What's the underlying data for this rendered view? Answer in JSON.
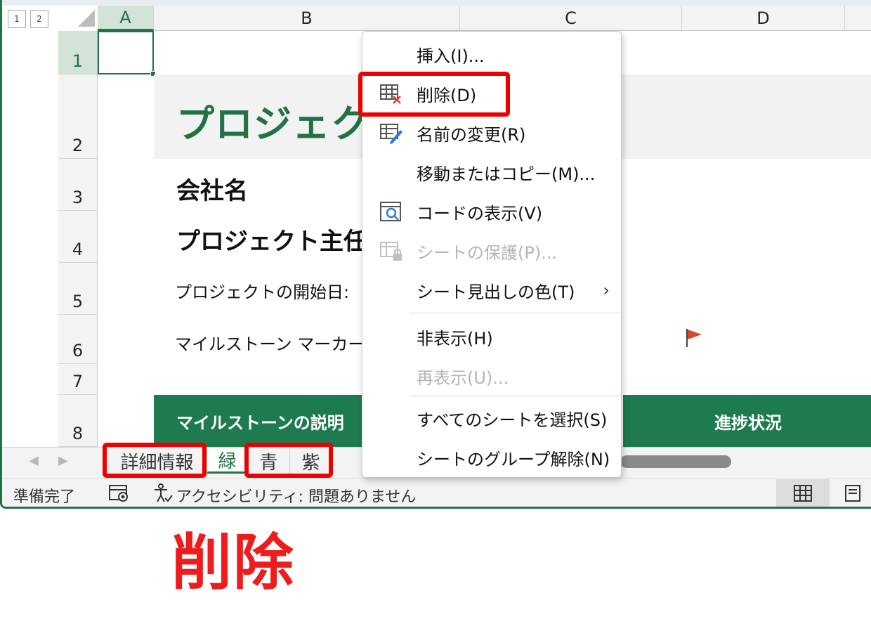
{
  "outline_levels": [
    "1",
    "2"
  ],
  "columns": [
    {
      "label": "A",
      "selected": true
    },
    {
      "label": "B",
      "selected": false
    },
    {
      "label": "C",
      "selected": false
    },
    {
      "label": "D",
      "selected": false
    }
  ],
  "rows": [
    "1",
    "2",
    "3",
    "4",
    "5",
    "6",
    "7",
    "8"
  ],
  "sheet": {
    "title": "プロジェクト",
    "company_label": "会社名",
    "lead_label": "プロジェクト主任",
    "start_date_label": "プロジェクトの開始日:",
    "milestone_marker_label": "マイルストーン マーカー:",
    "header_milestone_desc": "マイルストーンの説明",
    "header_progress": "進捗状況",
    "flag_icon": "red-flag-icon"
  },
  "context_menu": {
    "items": [
      {
        "label": "挿入(I)...",
        "icon": "",
        "disabled": false
      },
      {
        "label": "削除(D)",
        "icon": "delete-sheet-icon",
        "disabled": false
      },
      {
        "label": "名前の変更(R)",
        "icon": "rename-sheet-icon",
        "disabled": false
      },
      {
        "label": "移動またはコピー(M)...",
        "icon": "",
        "disabled": false
      },
      {
        "label": "コードの表示(V)",
        "icon": "view-code-icon",
        "disabled": false
      },
      {
        "label": "シートの保護(P)...",
        "icon": "protect-sheet-icon",
        "disabled": true
      },
      {
        "label": "シート見出しの色(T)",
        "icon": "",
        "disabled": false,
        "submenu": true
      },
      {
        "label": "非表示(H)",
        "icon": "",
        "disabled": false
      },
      {
        "label": "再表示(U)...",
        "icon": "",
        "disabled": true
      },
      {
        "label": "すべてのシートを選択(S)",
        "icon": "",
        "disabled": false
      },
      {
        "label": "シートのグループ解除(N)",
        "icon": "",
        "disabled": false
      }
    ]
  },
  "sheet_tabs": [
    {
      "label": "詳細情報",
      "active": false
    },
    {
      "label": "緑",
      "active": true
    },
    {
      "label": "青",
      "active": false
    },
    {
      "label": "紫",
      "active": false
    }
  ],
  "status_bar": {
    "ready": "準備完了",
    "accessibility": "アクセシビリティ: 問題ありません"
  },
  "annotation": {
    "caption": "削除"
  },
  "colors": {
    "excel_green": "#217346",
    "header_band": "#1d7b4f",
    "highlight_red": "#ee0000"
  }
}
